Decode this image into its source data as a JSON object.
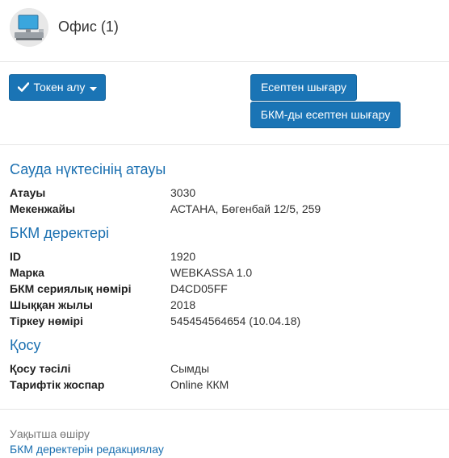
{
  "header": {
    "title": "Офис (1)",
    "avatar_icon": "computer-monitor-icon"
  },
  "toolbar": {
    "token_label": "Токен алу",
    "report_label": "Есептен шығару",
    "kkm_report_label": "БКМ-ды есептен шығару"
  },
  "sections": {
    "point": {
      "title": "Сауда нүктесінің атауы",
      "rows": [
        {
          "label": "Атауы",
          "value": "3030"
        },
        {
          "label": "Мекенжайы",
          "value": "АСТАНА, Бөгенбай 12/5, 259"
        }
      ]
    },
    "kkm": {
      "title": "БКМ деректері",
      "rows": [
        {
          "label": "ID",
          "value": "1920"
        },
        {
          "label": "Марка",
          "value": "WEBKASSA 1.0"
        },
        {
          "label": "БКМ сериялық нөмірі",
          "value": "D4CD05FF"
        },
        {
          "label": "Шыққан жылы",
          "value": "2018"
        },
        {
          "label": "Тіркеу нөмірі",
          "value": "545454564654 (10.04.18)"
        }
      ]
    },
    "connection": {
      "title": "Қосу",
      "rows": [
        {
          "label": "Қосу тәсілі",
          "value": "Сымды"
        },
        {
          "label": "Тарифтік жоспар",
          "value": "Online ККМ"
        }
      ]
    }
  },
  "footer": {
    "temp_delete": "Уақытша өшіру",
    "edit_kkm": "БКМ деректерін редакциялау"
  },
  "colors": {
    "primary": "#1a74b5",
    "link": "#1a6fb0",
    "muted": "#777777"
  }
}
